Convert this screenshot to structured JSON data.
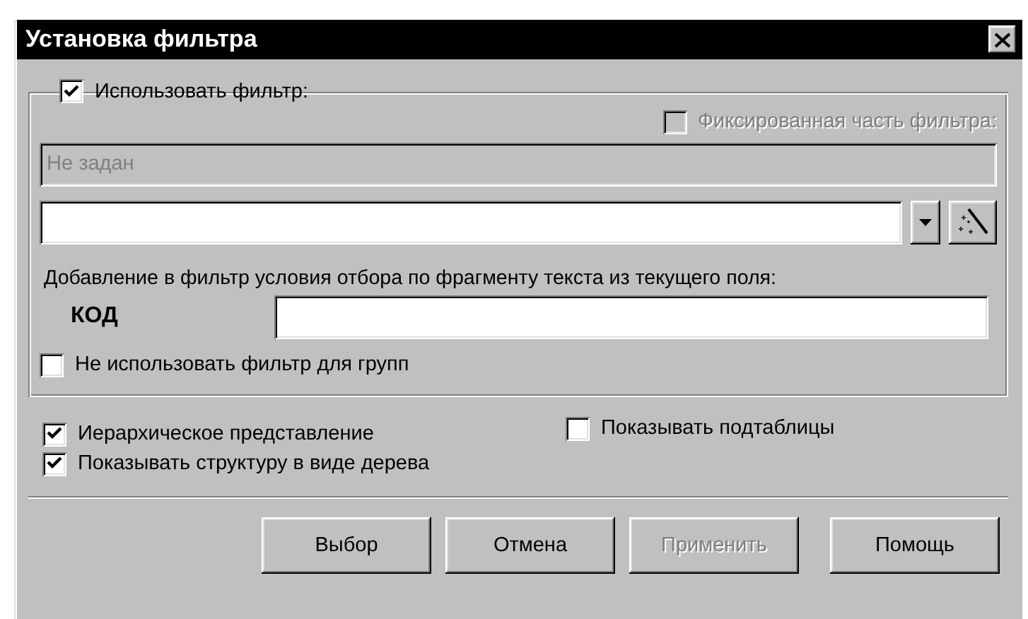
{
  "window": {
    "title": "Установка фильтра"
  },
  "filter_group": {
    "use_filter": {
      "label": "Использовать фильтр:",
      "checked": true
    },
    "fixed_part": {
      "label": "Фиксированная часть фильтра:",
      "checked": false,
      "disabled": true
    },
    "current_filter": {
      "value": "Не задан",
      "disabled": true
    },
    "fragment_caption": "Добавление в фильтр условия отбора по фрагменту текста из текущего поля:",
    "field_label": "КОД",
    "no_groups": {
      "label": "Не использовать фильтр для групп",
      "checked": false
    }
  },
  "options": [
    {
      "label": "Иерархическое представление",
      "checked": true
    },
    {
      "label": "Показывать структуру в виде дерева",
      "checked": true
    },
    {
      "label": "Показывать подтаблицы",
      "checked": false
    }
  ],
  "buttons": [
    {
      "label": "Выбор",
      "disabled": false
    },
    {
      "label": "Отмена",
      "disabled": false
    },
    {
      "label": "Применить",
      "disabled": true
    },
    {
      "label": "Помощь",
      "disabled": false
    }
  ]
}
